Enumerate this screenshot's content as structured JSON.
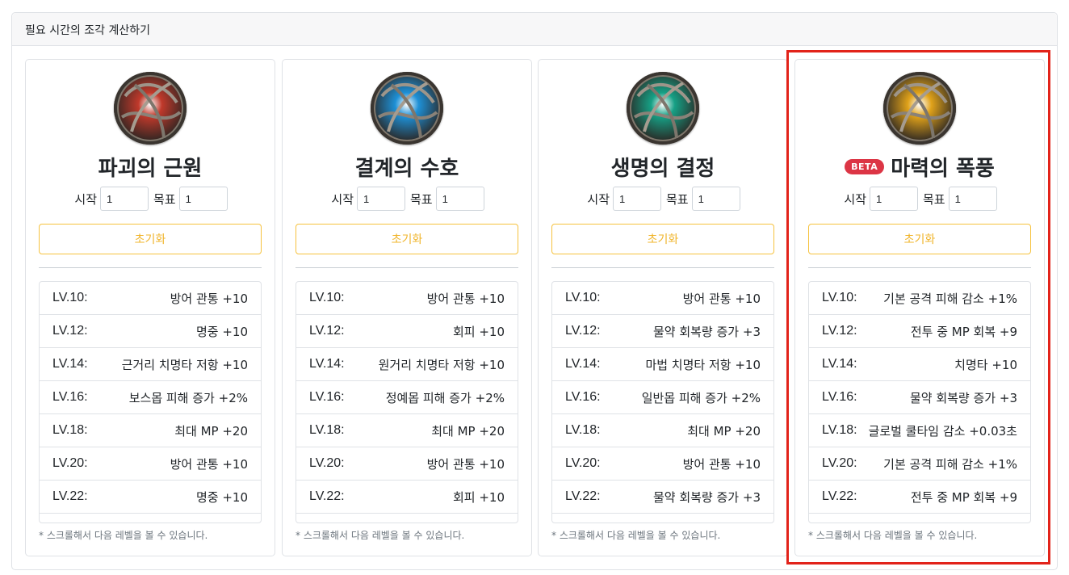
{
  "header": {
    "title": "필요 시간의 조각 계산하기"
  },
  "labels": {
    "start": "시작",
    "target": "목표",
    "reset": "초기화",
    "hint": "* 스크롤해서 다음 레벨을 볼 수 있습니다.",
    "beta": "BETA"
  },
  "cards": [
    {
      "title": "파괴의 근원",
      "icon": "red-orb-icon",
      "color": "#c0392b",
      "start": "1",
      "target": "1",
      "levels": [
        {
          "lv": "LV.10:",
          "effect": "방어 관통 +10"
        },
        {
          "lv": "LV.12:",
          "effect": "명중 +10"
        },
        {
          "lv": "LV.14:",
          "effect": "근거리 치명타 저항 +10"
        },
        {
          "lv": "LV.16:",
          "effect": "보스몹 피해 증가 +2%"
        },
        {
          "lv": "LV.18:",
          "effect": "최대 MP +20"
        },
        {
          "lv": "LV.20:",
          "effect": "방어 관통 +10"
        },
        {
          "lv": "LV.22:",
          "effect": "명중 +10"
        }
      ]
    },
    {
      "title": "결계의 수호",
      "icon": "blue-orb-icon",
      "color": "#1e90d6",
      "start": "1",
      "target": "1",
      "levels": [
        {
          "lv": "LV.10:",
          "effect": "방어 관통 +10"
        },
        {
          "lv": "LV.12:",
          "effect": "회피 +10"
        },
        {
          "lv": "LV.14:",
          "effect": "원거리 치명타 저항 +10"
        },
        {
          "lv": "LV.16:",
          "effect": "정예몹 피해 증가 +2%"
        },
        {
          "lv": "LV.18:",
          "effect": "최대 MP +20"
        },
        {
          "lv": "LV.20:",
          "effect": "방어 관통 +10"
        },
        {
          "lv": "LV.22:",
          "effect": "회피 +10"
        }
      ]
    },
    {
      "title": "생명의 결정",
      "icon": "green-orb-icon",
      "color": "#16a085",
      "start": "1",
      "target": "1",
      "levels": [
        {
          "lv": "LV.10:",
          "effect": "방어 관통 +10"
        },
        {
          "lv": "LV.12:",
          "effect": "물약 회복량 증가 +3"
        },
        {
          "lv": "LV.14:",
          "effect": "마법 치명타 저항 +10"
        },
        {
          "lv": "LV.16:",
          "effect": "일반몹 피해 증가 +2%"
        },
        {
          "lv": "LV.18:",
          "effect": "최대 MP +20"
        },
        {
          "lv": "LV.20:",
          "effect": "방어 관통 +10"
        },
        {
          "lv": "LV.22:",
          "effect": "물약 회복량 증가 +3"
        }
      ]
    },
    {
      "title": "마력의 폭풍",
      "icon": "gold-orb-icon",
      "color": "#e0a21a",
      "start": "1",
      "target": "1",
      "beta": true,
      "levels": [
        {
          "lv": "LV.10:",
          "effect": "기본 공격 피해 감소 +1%"
        },
        {
          "lv": "LV.12:",
          "effect": "전투 중 MP 회복 +9"
        },
        {
          "lv": "LV.14:",
          "effect": "치명타 +10"
        },
        {
          "lv": "LV.16:",
          "effect": "물약 회복량 증가 +3"
        },
        {
          "lv": "LV.18:",
          "effect": "글로벌 쿨타임 감소 +0.03초"
        },
        {
          "lv": "LV.20:",
          "effect": "기본 공격 피해 감소 +1%"
        },
        {
          "lv": "LV.22:",
          "effect": "전투 중 MP 회복 +9"
        }
      ]
    }
  ],
  "highlight_color": "#e2231a"
}
